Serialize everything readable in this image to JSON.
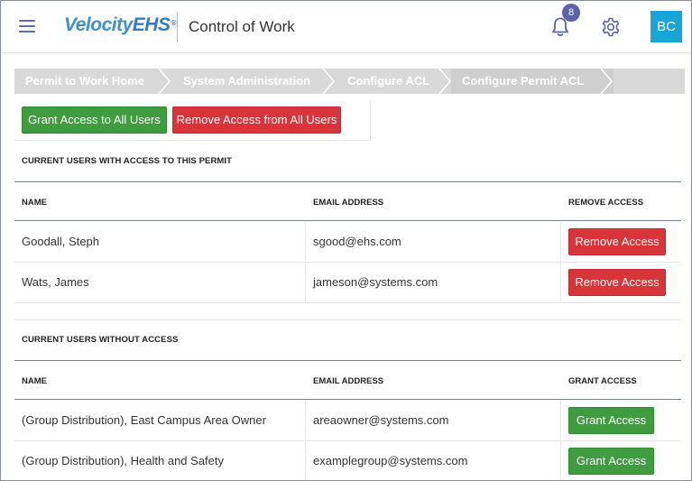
{
  "header": {
    "logo_main": "Velocity",
    "logo_accent": "EHS",
    "logo_mark": "®",
    "app_title": "Control of Work",
    "notification_count": "8",
    "avatar_initials": "BC"
  },
  "breadcrumb": [
    {
      "label": "Permit to Work Home"
    },
    {
      "label": "System Administration"
    },
    {
      "label": "Configure ACL"
    },
    {
      "label": "Configure Permit ACL"
    }
  ],
  "actions": {
    "grant_all_label": "Grant Access to All Users",
    "remove_all_label": "Remove Access from All Users"
  },
  "with_access": {
    "title": "CURRENT USERS WITH ACCESS TO THIS PERMIT",
    "columns": {
      "name": "NAME",
      "email": "EMAIL ADDRESS",
      "action": "REMOVE ACCESS"
    },
    "rows": [
      {
        "name": "Goodall, Steph",
        "email": "sgood@ehs.com",
        "action_label": "Remove Access"
      },
      {
        "name": "Wats, James",
        "email": "jameson@systems.com",
        "action_label": "Remove Access"
      }
    ]
  },
  "without_access": {
    "title": "CURRENT USERS WITHOUT ACCESS",
    "columns": {
      "name": "NAME",
      "email": "EMAIL ADDRESS",
      "action": "GRANT ACCESS"
    },
    "rows": [
      {
        "name": "(Group Distribution), East Campus Area Owner",
        "email": "areaowner@systems.com",
        "action_label": "Grant Access"
      },
      {
        "name": "(Group Distribution), Health and Safety",
        "email": "examplegroup@systems.com",
        "action_label": "Grant Access"
      }
    ]
  },
  "colors": {
    "accent": "#5b64a8",
    "avatar": "#17a4d6",
    "grant": "#3f9c3f",
    "remove": "#d9343a",
    "breadcrumb": "#d9d9d9"
  },
  "icons": {
    "menu": "hamburger-menu-icon",
    "notifications": "bell-icon",
    "settings": "gear-icon"
  }
}
